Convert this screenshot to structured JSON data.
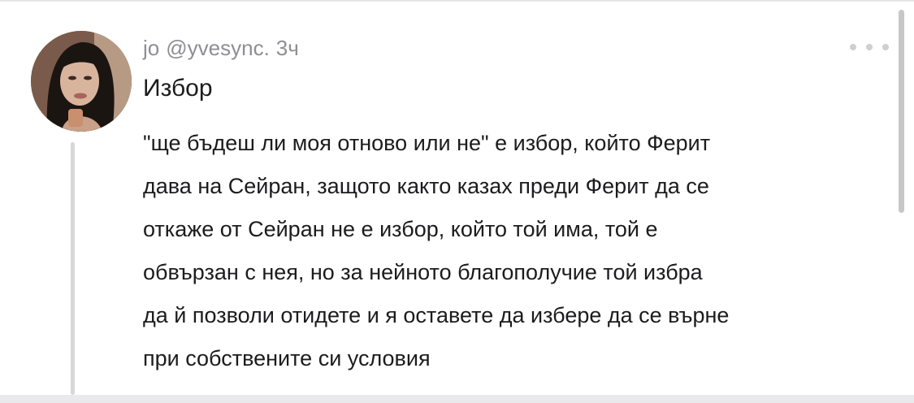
{
  "post": {
    "display_name": "jo",
    "handle": "@yvesync.",
    "time": "3ч",
    "title": "Избор",
    "body_lines": [
      "\"ще бъдеш ли моя отново или не\" е избор, който Ферит",
      "дава на Сейран, защото както казах преди Ферит да се",
      "откаже от Сейран не е избор, който той има, той е",
      "обвързан с нея, но за нейното благополучие той избра",
      "да й позволи отидете и я оставете да избере да се върне",
      "при собствените си условия"
    ]
  },
  "icons": {
    "more": "more-dots-icon",
    "avatar": "profile-avatar"
  },
  "colors": {
    "meta_text": "#8e8e93",
    "body_text": "#1c1c1e",
    "thread_line": "#d7d7d7"
  }
}
